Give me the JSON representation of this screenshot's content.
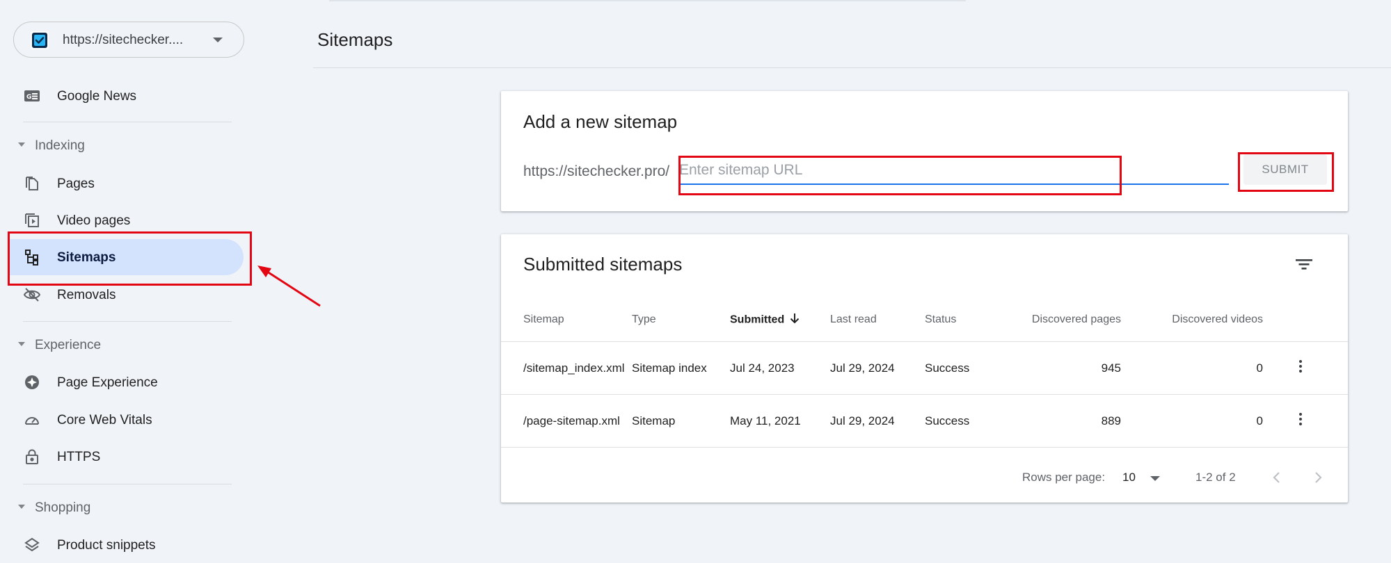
{
  "property": {
    "url": "https://sitechecker...."
  },
  "sidebar": {
    "google_news": "Google News",
    "sections": {
      "indexing": "Indexing",
      "experience": "Experience",
      "shopping": "Shopping"
    },
    "items": {
      "pages": "Pages",
      "video_pages": "Video pages",
      "sitemaps": "Sitemaps",
      "removals": "Removals",
      "page_experience": "Page Experience",
      "core_web_vitals": "Core Web Vitals",
      "https": "HTTPS",
      "product_snippets": "Product snippets"
    }
  },
  "page": {
    "title": "Sitemaps"
  },
  "add_card": {
    "title": "Add a new sitemap",
    "prefix": "https://sitechecker.pro/",
    "placeholder": "Enter sitemap URL",
    "value": "",
    "submit": "SUBMIT"
  },
  "submitted": {
    "title": "Submitted sitemaps",
    "columns": {
      "sitemap": "Sitemap",
      "type": "Type",
      "submitted": "Submitted",
      "last_read": "Last read",
      "status": "Status",
      "discovered_pages": "Discovered pages",
      "discovered_videos": "Discovered videos"
    },
    "rows": [
      {
        "sitemap": "/sitemap_index.xml",
        "type": "Sitemap index",
        "submitted": "Jul 24, 2023",
        "last_read": "Jul 29, 2024",
        "status": "Success",
        "pages": "945",
        "videos": "0"
      },
      {
        "sitemap": "/page-sitemap.xml",
        "type": "Sitemap",
        "submitted": "May 11, 2021",
        "last_read": "Jul 29, 2024",
        "status": "Success",
        "pages": "889",
        "videos": "0"
      }
    ],
    "pagination": {
      "rows_label": "Rows per page:",
      "rows_value": "10",
      "range": "1-2 of 2"
    }
  },
  "colors": {
    "active_nav": "#d3e3fd",
    "success": "#188038",
    "accent": "#1a73e8",
    "annotation": "#e30613"
  }
}
